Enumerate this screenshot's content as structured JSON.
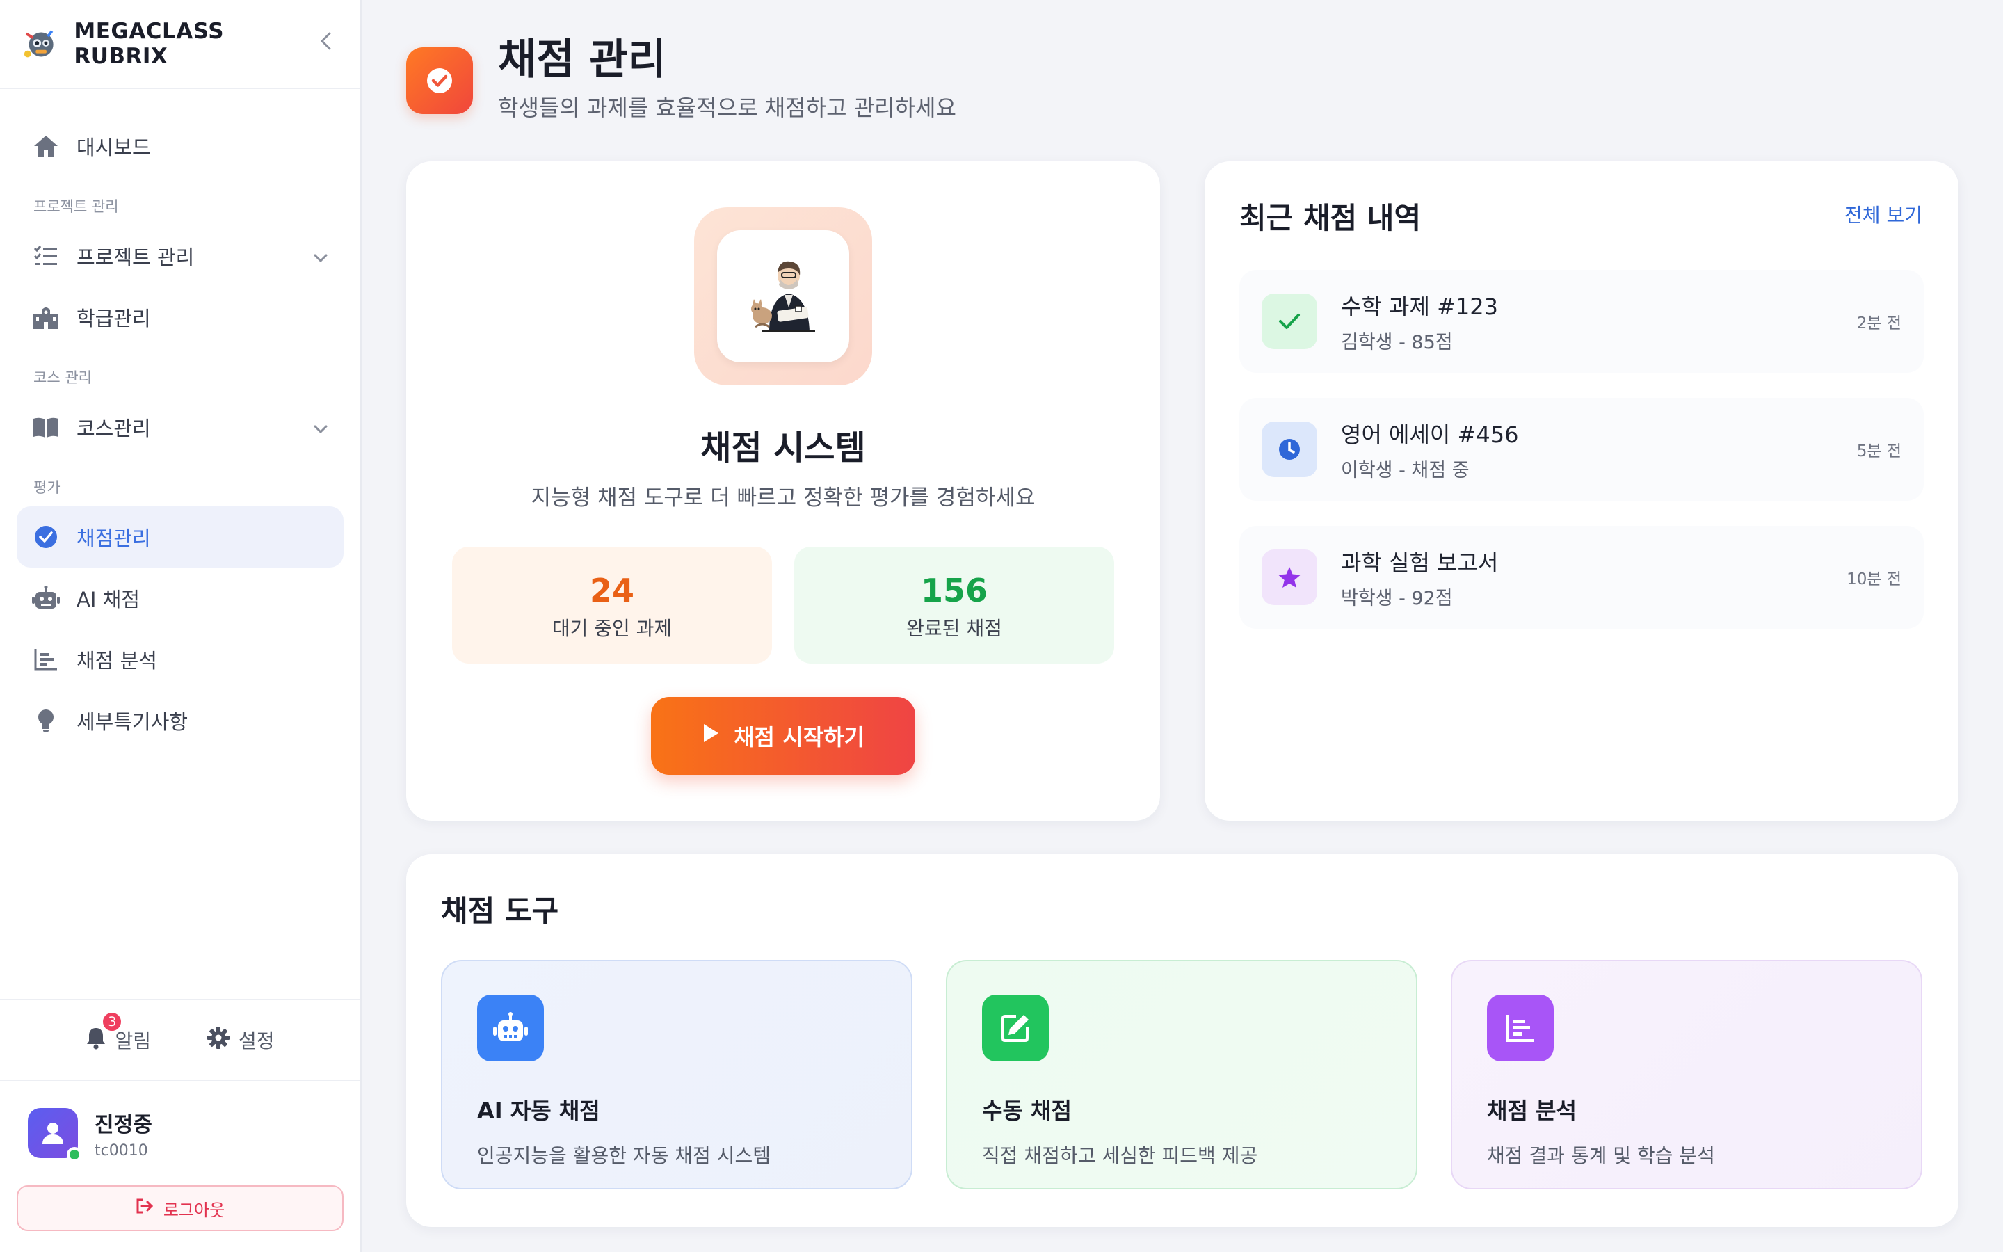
{
  "app": {
    "name": "MEGACLASS RUBRIX"
  },
  "sidebar": {
    "dashboard": "대시보드",
    "section_project": "프로젝트 관리",
    "project_item": "프로젝트 관리",
    "class_item": "학급관리",
    "section_course": "코스 관리",
    "course_item": "코스관리",
    "section_eval": "평가",
    "grading_item": "채점관리",
    "ai_item": "AI 채점",
    "analysis_item": "채점 분석",
    "detail_item": "세부특기사항",
    "notifications": "알림",
    "notifications_count": "3",
    "settings": "설정",
    "user_name": "진정중",
    "user_id": "tc0010",
    "logout": "로그아웃"
  },
  "header": {
    "title": "채점 관리",
    "subtitle": "학생들의 과제를 효율적으로 채점하고 관리하세요"
  },
  "hero": {
    "title": "채점 시스템",
    "subtitle": "지능형 채점 도구로 더 빠르고 정확한 평가를 경험하세요",
    "pending_count": "24",
    "pending_label": "대기 중인 과제",
    "done_count": "156",
    "done_label": "완료된 채점",
    "start_button": "채점 시작하기"
  },
  "recent": {
    "title": "최근 채점 내역",
    "view_all": "전체 보기",
    "items": [
      {
        "title": "수학 과제 #123",
        "sub": "김학생 - 85점",
        "time": "2분 전",
        "icon": "check-icon"
      },
      {
        "title": "영어 에세이 #456",
        "sub": "이학생 - 채점 중",
        "time": "5분 전",
        "icon": "clock-icon"
      },
      {
        "title": "과학 실험 보고서",
        "sub": "박학생 - 92점",
        "time": "10분 전",
        "icon": "star-icon"
      }
    ]
  },
  "tools": {
    "title": "채점 도구",
    "items": [
      {
        "name": "AI 자동 채점",
        "desc": "인공지능을 활용한 자동 채점 시스템",
        "icon": "robot-icon",
        "color": "#3b82f6"
      },
      {
        "name": "수동 채점",
        "desc": "직접 채점하고 세심한 피드백 제공",
        "icon": "edit-icon",
        "color": "#22c55e"
      },
      {
        "name": "채점 분석",
        "desc": "채점 결과 통계 및 학습 분석",
        "icon": "chart-icon",
        "color": "#a855f7"
      }
    ]
  },
  "colors": {
    "accent": "#3b6fe0",
    "brand_orange": "#f97316",
    "brand_red": "#ef4444",
    "success": "#16a34a"
  }
}
